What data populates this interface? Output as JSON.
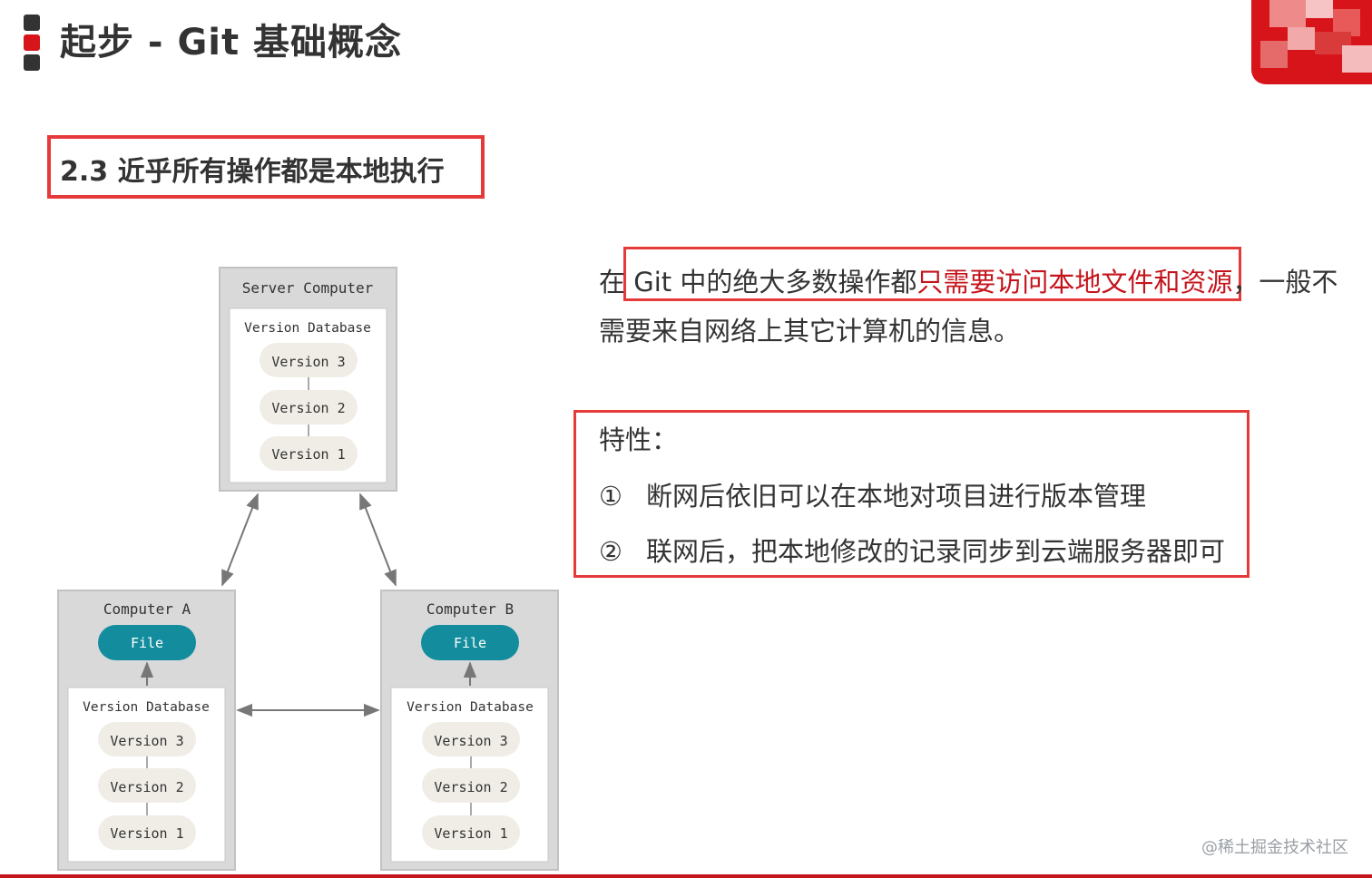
{
  "header": {
    "title": "起步 - Git 基础概念",
    "bar_colors": [
      "#333333",
      "#d7141a",
      "#333333"
    ]
  },
  "section": {
    "title": "2.3 近乎所有操作都是本地执行"
  },
  "diagram": {
    "server": {
      "label": "Server Computer",
      "db_label": "Version Database",
      "versions": [
        "Version 3",
        "Version 2",
        "Version 1"
      ]
    },
    "computer_a": {
      "label": "Computer A",
      "file": "File",
      "db_label": "Version Database",
      "versions": [
        "Version 3",
        "Version 2",
        "Version 1"
      ]
    },
    "computer_b": {
      "label": "Computer B",
      "file": "File",
      "db_label": "Version Database",
      "versions": [
        "Version 3",
        "Version 2",
        "Version 1"
      ]
    },
    "colors": {
      "file": "#138d9d",
      "pill": "#efede6",
      "box": "#d9d9d9"
    }
  },
  "description": {
    "prefix": "在 ",
    "mid": "Git 中的绝大多数操作都",
    "highlight": "只需要访问本地文件和资源",
    "suffix_line1": "，一般不",
    "line2": "需要来自网络上其它计算机的信息。"
  },
  "features": {
    "title": "特性：",
    "items": [
      {
        "num": "①",
        "text": "断网后依旧可以在本地对项目进行版本管理"
      },
      {
        "num": "②",
        "text": "联网后，把本地修改的记录同步到云端服务器即可"
      }
    ]
  },
  "watermark": "@稀土掘金技术社区"
}
